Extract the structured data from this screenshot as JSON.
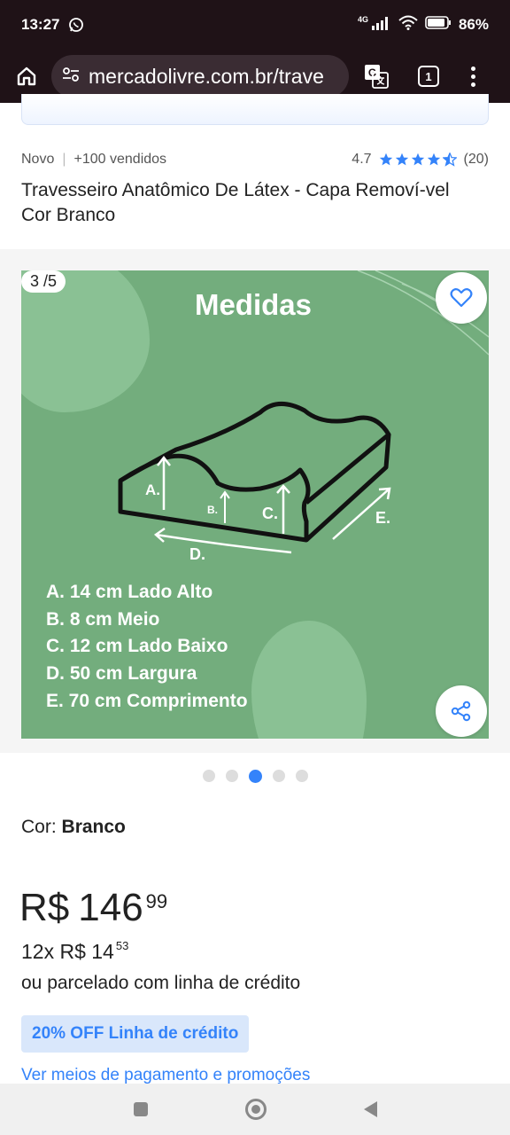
{
  "status": {
    "time": "13:27",
    "network": "4G",
    "battery": "86%"
  },
  "browser": {
    "url": "mercadolivre.com.br/trave",
    "tab_count": "1"
  },
  "product": {
    "condition": "Novo",
    "sold": "+100 vendidos",
    "rating": "4.7",
    "reviews": "(20)",
    "title": "Travesseiro Anatômico De Látex - Capa Removí-vel Cor Branco"
  },
  "gallery": {
    "counter": "3 /5",
    "image_title": "Medidas",
    "labels": {
      "a": "A.",
      "b": "B.",
      "c": "C.",
      "d": "D.",
      "e": "E."
    },
    "measures": [
      "A. 14 cm Lado Alto",
      "B. 8 cm Meio",
      "C. 12 cm Lado Baixo",
      "D. 50 cm Largura",
      "E. 70 cm Comprimento"
    ],
    "dots_active": 3
  },
  "color": {
    "label": "Cor:",
    "value": "Branco"
  },
  "price": {
    "currency": "R$",
    "amount": "146",
    "cents": "99",
    "installments": "12x R$ 14",
    "installment_cents": "53",
    "credit_text": "ou parcelado com linha de crédito",
    "badge": "20% OFF Linha de crédito",
    "payment_link": "Ver meios de pagamento e promoções"
  },
  "colors": {
    "accent": "#3483fa",
    "image_bg": "#73ad7d"
  }
}
